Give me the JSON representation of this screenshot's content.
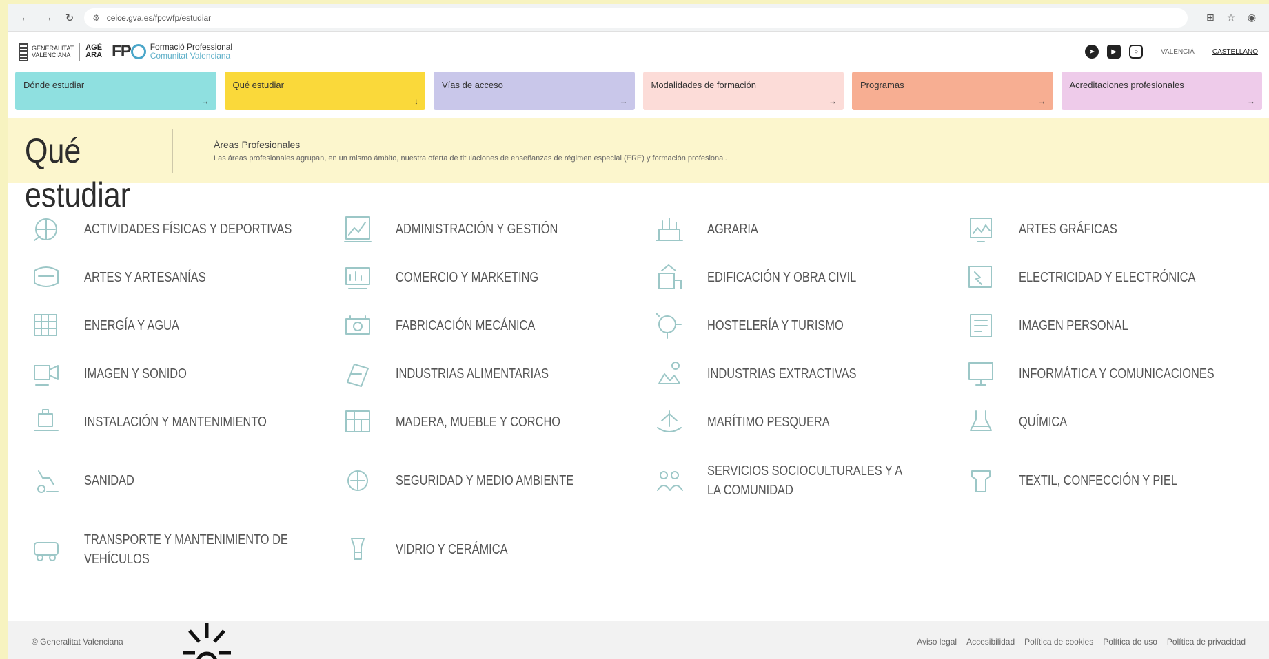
{
  "browser": {
    "url": "ceice.gva.es/fpcv/fp/estudiar"
  },
  "header": {
    "gv_line1": "GENERALITAT",
    "gv_line2": "VALENCIANA",
    "aq_line1": "AGÈ",
    "aq_line2": "ARA",
    "fp_mark": "FP",
    "fp_title": "Formació Professional",
    "fp_subtitle": "Comunitat Valenciana",
    "languages": [
      "VALENCIÀ",
      "CASTELLANO"
    ]
  },
  "nav": [
    {
      "label": "Dónde estudiar",
      "color": "#8fe0e0",
      "arrow": "→"
    },
    {
      "label": "Qué estudiar",
      "color": "#fad93a",
      "arrow": "↓"
    },
    {
      "label": "Vías de acceso",
      "color": "#c9c7ea",
      "arrow": "→"
    },
    {
      "label": "Modalidades de formación",
      "color": "#fcdcd8",
      "arrow": "→"
    },
    {
      "label": "Programas",
      "color": "#f7ae92",
      "arrow": "→"
    },
    {
      "label": "Acreditaciones profesionales",
      "color": "#eecbea",
      "arrow": "→"
    }
  ],
  "hero": {
    "title": "Qué estudiar",
    "intro_title": "Áreas Profesionales",
    "intro_text": "Las áreas profesionales agrupan, en un mismo ámbito, nuestra oferta de titulaciones de enseñanzas de régimen especial (ERE) y formación profesional."
  },
  "areas": [
    "Actividades físicas y deportivas",
    "Administración y gestión",
    "Agraria",
    "Artes gráficas",
    "Artes y artesanías",
    "Comercio y marketing",
    "Edificación y obra civil",
    "Electricidad y electrónica",
    "Energía y agua",
    "Fabricación mecánica",
    "Hostelería y turismo",
    "Imagen personal",
    "Imagen y sonido",
    "Industrias alimentarias",
    "Industrias extractivas",
    "Informática y comunicaciones",
    "Instalación y mantenimiento",
    "Madera, mueble y corcho",
    "Marítimo pesquera",
    "Química",
    "Sanidad",
    "Seguridad y medio ambiente",
    "Servicios socioculturales y a la comunidad",
    "Textil, confección y piel",
    "Transporte y mantenimiento de vehículos",
    "Vidrio y cerámica"
  ],
  "footer": {
    "copyright": "© Generalitat Valenciana",
    "links": [
      "Aviso legal",
      "Accesibilidad",
      "Política de cookies",
      "Política de uso",
      "Política de privacidad"
    ]
  },
  "colors": {
    "page_bg": "#f7f3c0",
    "hero_bg": "#fcf6cd",
    "icon_stroke": "#9cc7c7"
  }
}
